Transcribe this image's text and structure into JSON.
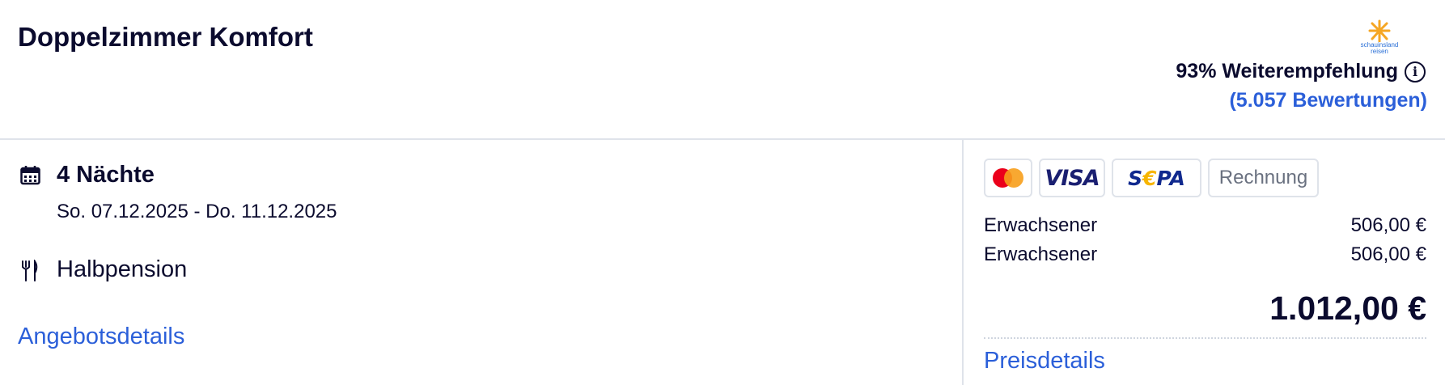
{
  "offer": {
    "room_title": "Doppelzimmer Komfort",
    "logo_text_line1": "schauinsland",
    "logo_text_line2": "reisen",
    "recommendation": "93% Weiterempfehlung",
    "reviews_link": "(5.057 Bewertungen)"
  },
  "stay": {
    "nights": "4 Nächte",
    "dates": "So. 07.12.2025 - Do. 11.12.2025",
    "board": "Halbpension",
    "details_link": "Angebotsdetails"
  },
  "payments": {
    "visa": "VISA",
    "sepa_s": "S",
    "sepa_euro": "€",
    "sepa_pa": "PA",
    "invoice": "Rechnung"
  },
  "pricing": {
    "rows": [
      {
        "label": "Erwachsener",
        "amount": "506,00 €"
      },
      {
        "label": "Erwachsener",
        "amount": "506,00 €"
      }
    ],
    "total": "1.012,00 €",
    "details_link": "Preisdetails"
  },
  "icons": {
    "calendar": "calendar-icon",
    "cutlery": "fork-knife-icon",
    "info": "info-icon",
    "logo_sun": "sun-logo-icon"
  },
  "colors": {
    "link": "#2b5fd9",
    "text": "#0b0b2e",
    "logo_sun": "#f5a623",
    "mastercard_red": "#eb001b",
    "mastercard_yellow": "#f79e1b",
    "visa": "#1a1f71",
    "sepa_blue": "#10298e",
    "sepa_yellow": "#f7b500"
  }
}
